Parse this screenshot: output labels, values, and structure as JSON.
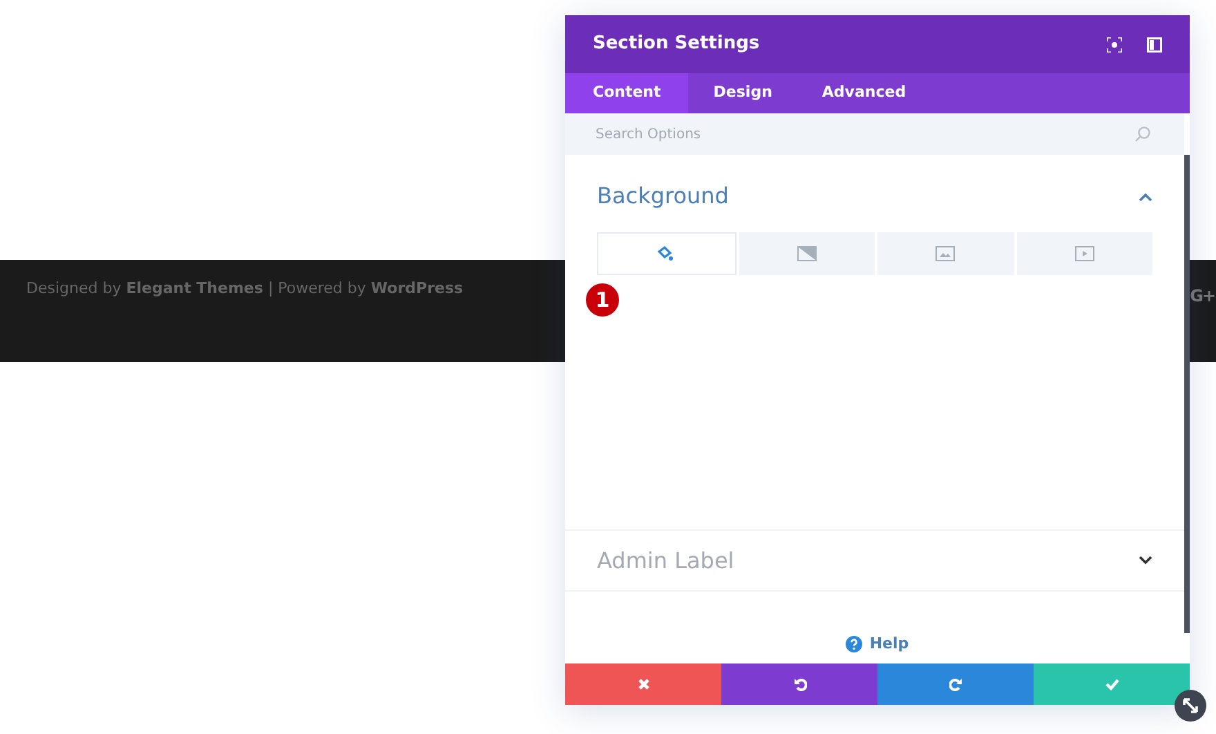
{
  "footer": {
    "credit": "Designed by **Elegant Themes** | Powered by **WordPress**",
    "social": "G+"
  },
  "modal": {
    "title": "Section Settings",
    "tabs": [
      {
        "label": "Content",
        "selected": true
      },
      {
        "label": "Design",
        "selected": false
      },
      {
        "label": "Advanced",
        "selected": false
      }
    ],
    "search": {
      "placeholder": "Search Options"
    },
    "sections": [
      {
        "title": "Background",
        "expanded": true,
        "background_tabs": [
          {
            "kind": "color",
            "selected": true
          },
          {
            "kind": "gradient",
            "selected": false
          },
          {
            "kind": "image",
            "selected": false
          },
          {
            "kind": "video",
            "selected": false
          }
        ]
      },
      {
        "title": "Admin Label",
        "expanded": false
      }
    ],
    "help": "Help",
    "actions": [
      {
        "kind": "cancel"
      },
      {
        "kind": "undo"
      },
      {
        "kind": "redo"
      },
      {
        "kind": "save"
      }
    ]
  },
  "step_badge": "1"
}
